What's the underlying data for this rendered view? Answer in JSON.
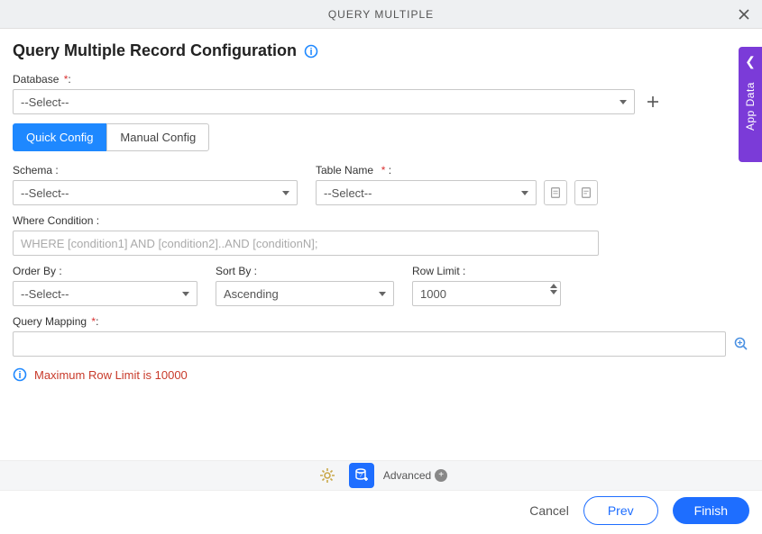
{
  "header": {
    "title": "QUERY MULTIPLE"
  },
  "page_title": "Query Multiple Record Configuration",
  "labels": {
    "database": "Database",
    "schema": "Schema :",
    "table_name": "Table Name",
    "where": "Where Condition :",
    "order_by": "Order By :",
    "sort_by": "Sort By :",
    "row_limit": "Row Limit :",
    "query_mapping": "Query Mapping"
  },
  "tabs": {
    "quick": "Quick Config",
    "manual": "Manual Config"
  },
  "fields": {
    "database": "--Select--",
    "schema": "--Select--",
    "table_name": "--Select--",
    "where_placeholder": "WHERE [condition1] AND [condition2]..AND [conditionN];",
    "order_by": "--Select--",
    "sort_by": "Ascending",
    "row_limit": "1000",
    "query_mapping": ""
  },
  "warning": "Maximum Row Limit is 10000",
  "footer": {
    "advanced": "Advanced"
  },
  "buttons": {
    "cancel": "Cancel",
    "prev": "Prev",
    "finish": "Finish"
  },
  "side_panel": "App Data"
}
